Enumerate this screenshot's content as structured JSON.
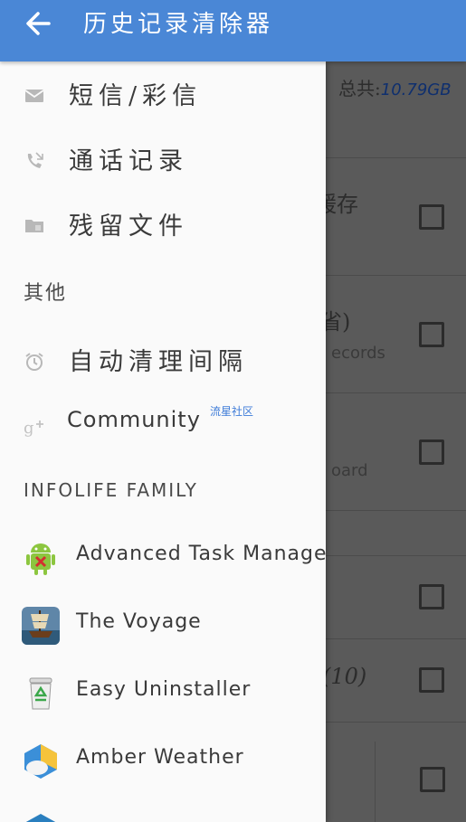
{
  "appbar": {
    "title": "历史记录清除器",
    "back_icon": "arrow-left-icon"
  },
  "drawer": {
    "items": [
      {
        "label": "短信/彩信",
        "icon": "mail-icon"
      },
      {
        "label": "通话记录",
        "icon": "phone-call-icon"
      },
      {
        "label": "残留文件",
        "icon": "folder-icon"
      }
    ],
    "other_section": "其他",
    "other_items": [
      {
        "label": "自动清理间隔",
        "icon": "alarm-clock-icon"
      },
      {
        "label": "Community",
        "icon": "google-plus-icon",
        "badge": "流星社区"
      }
    ],
    "family_section": "INFOLIFE FAMILY",
    "family_apps": [
      {
        "label": "Advanced Task Manager",
        "icon": "android-task-manager-icon"
      },
      {
        "label": "The Voyage",
        "icon": "sailing-ship-icon"
      },
      {
        "label": "Easy Uninstaller",
        "icon": "recycle-bin-icon"
      },
      {
        "label": "Amber Weather",
        "icon": "weather-cloud-icon"
      }
    ]
  },
  "background": {
    "total_label": "总共:",
    "total_value": "10.79GB",
    "fragments": [
      "缓存",
      "省)",
      "ecords",
      "oard",
      "(10)"
    ]
  },
  "colors": {
    "appbar": "#4a87d6",
    "drawer": "#fafafa",
    "scrim": "#5a5a5a"
  }
}
